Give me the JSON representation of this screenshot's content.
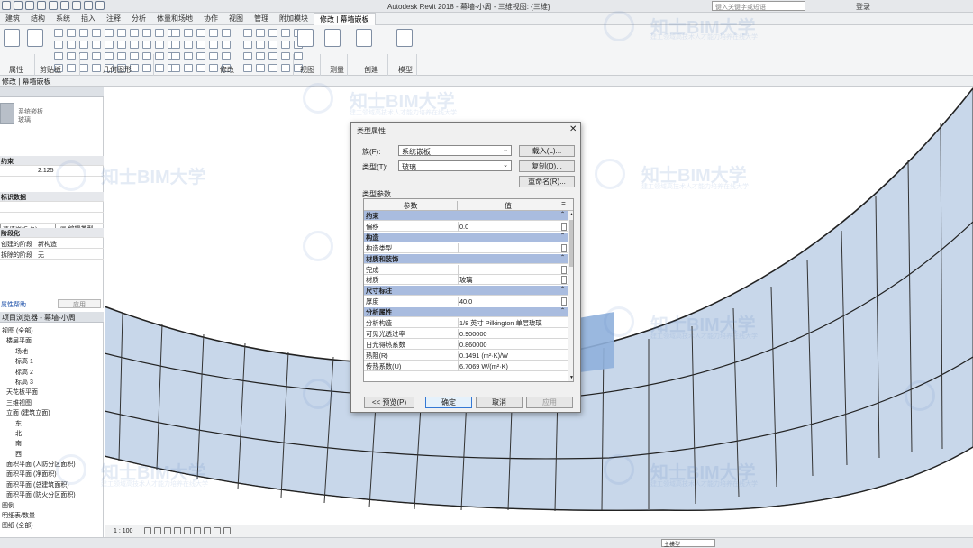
{
  "app": {
    "title": "Autodesk Revit 2018 -",
    "doc_title": "幕墙-小周 - 三维视图: {三维}",
    "search_placeholder": "键入关键字或短语",
    "login": "登录"
  },
  "ribbon": {
    "tabs": [
      "建筑",
      "结构",
      "系统",
      "插入",
      "注释",
      "分析",
      "体量和场地",
      "协作",
      "视图",
      "管理",
      "附加模块",
      "修改 | 幕墙嵌板"
    ],
    "panels": [
      "属性",
      "剪贴板",
      "几何图形",
      "修改",
      "视图",
      "测量",
      "创建",
      "模型"
    ]
  },
  "mode_bar": "修改 | 幕墙嵌板",
  "properties": {
    "type_name": [
      "系统嵌板",
      "玻璃"
    ],
    "instance_selector": "幕墙嵌板 (1)",
    "edit_type": "编辑类型",
    "rows": [
      {
        "k": "约束",
        "v": "",
        "section": true
      },
      {
        "k": "",
        "v": "2.125"
      },
      {
        "k": "",
        "v": ""
      },
      {
        "k": "标识数据",
        "v": "",
        "section": true
      },
      {
        "k": "",
        "v": ""
      },
      {
        "k": "",
        "v": ""
      },
      {
        "k": "阶段化",
        "v": "",
        "section": true
      },
      {
        "k": "创建的阶段",
        "v": "新构造"
      },
      {
        "k": "拆除的阶段",
        "v": "无"
      }
    ],
    "help": "属性帮助",
    "apply": "应用"
  },
  "browser": {
    "header": "项目浏览器 - 幕墙-小周",
    "items": [
      {
        "label": "视图 (全部)",
        "indent": 0
      },
      {
        "label": "楼层平面",
        "indent": 1
      },
      {
        "label": "场地",
        "indent": 3
      },
      {
        "label": "标高 1",
        "indent": 3
      },
      {
        "label": "标高 2",
        "indent": 3
      },
      {
        "label": "标高 3",
        "indent": 3
      },
      {
        "label": "天花板平面",
        "indent": 1
      },
      {
        "label": "三维视图",
        "indent": 1
      },
      {
        "label": "立面 (建筑立面)",
        "indent": 1
      },
      {
        "label": "东",
        "indent": 3
      },
      {
        "label": "北",
        "indent": 3
      },
      {
        "label": "南",
        "indent": 3
      },
      {
        "label": "西",
        "indent": 3
      },
      {
        "label": "面积平面 (人防分区面积)",
        "indent": 1
      },
      {
        "label": "面积平面 (净面积)",
        "indent": 1
      },
      {
        "label": "面积平面 (总建筑面积)",
        "indent": 1
      },
      {
        "label": "面积平面 (防火分区面积)",
        "indent": 1
      },
      {
        "label": "图例",
        "indent": 0
      },
      {
        "label": "明细表/数量",
        "indent": 0
      },
      {
        "label": "图纸 (全部)",
        "indent": 0
      }
    ]
  },
  "status": {
    "scale": "1 : 100",
    "model": "主模型"
  },
  "dialog": {
    "title": "类型属性",
    "family_label": "族(F):",
    "family_value": "系统嵌板",
    "type_label": "类型(T):",
    "type_value": "玻璃",
    "load": "载入(L)...",
    "duplicate": "复制(D)...",
    "rename": "重命名(R)...",
    "section_label": "类型参数",
    "col_param": "参数",
    "col_value": "值",
    "rows": [
      {
        "k": "约束",
        "v": "",
        "section": true
      },
      {
        "k": "偏移",
        "v": "0.0"
      },
      {
        "k": "构造",
        "v": "",
        "section": true
      },
      {
        "k": "构造类型",
        "v": ""
      },
      {
        "k": "材质和装饰",
        "v": "",
        "section": true
      },
      {
        "k": "完成",
        "v": ""
      },
      {
        "k": "材质",
        "v": "玻璃"
      },
      {
        "k": "尺寸标注",
        "v": "",
        "section": true
      },
      {
        "k": "厚度",
        "v": "40.0"
      },
      {
        "k": "分析属性",
        "v": "",
        "section": true
      },
      {
        "k": "分析构造",
        "v": "1/8 英寸 Pilkington 单层玻璃"
      },
      {
        "k": "可见光透过率",
        "v": "0.900000"
      },
      {
        "k": "日光得热系数",
        "v": "0.860000"
      },
      {
        "k": "热阻(R)",
        "v": "0.1491 (m²·K)/W"
      },
      {
        "k": "传热系数(U)",
        "v": "6.7069 W/(m²·K)"
      }
    ],
    "preview": "<< 预览(P)",
    "ok": "确定",
    "cancel": "取消",
    "apply": "应用"
  },
  "watermark": {
    "brand": "知士BIM大学",
    "slogan": "建工领域高技术人才能力培养在线大学"
  }
}
